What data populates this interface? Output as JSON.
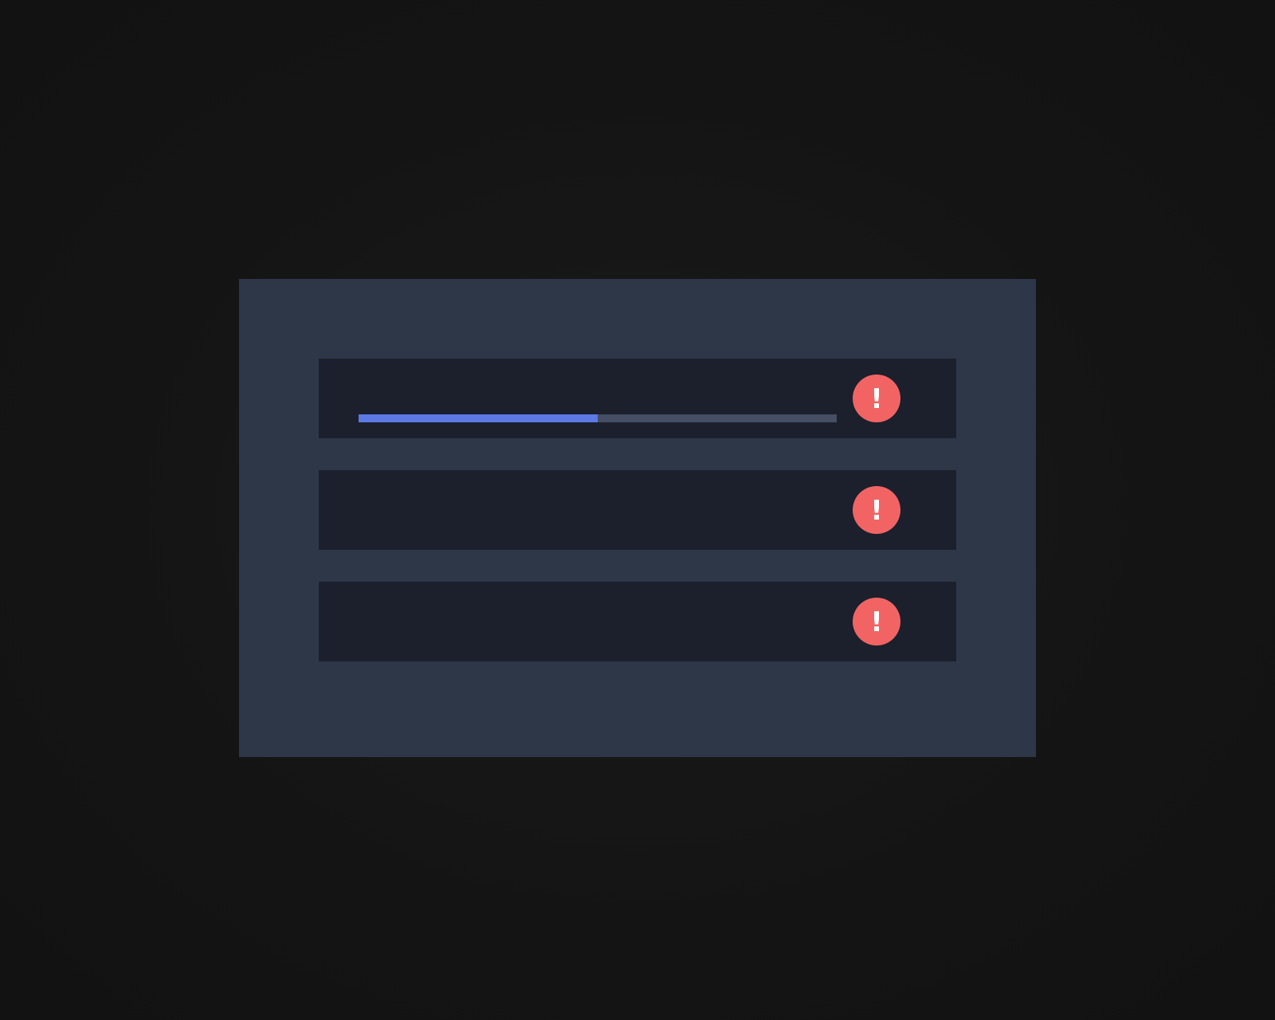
{
  "colors": {
    "background": "#141414",
    "panel": "#2e3748",
    "row": "#1b202c",
    "progress_track": "#454e62",
    "progress_fill": "#5d79e6",
    "alert": "#f26464"
  },
  "rows": [
    {
      "progress": 0.5,
      "status_icon": "alert-exclamation-icon",
      "status_glyph": "!"
    },
    {
      "status_icon": "alert-exclamation-icon",
      "status_glyph": "!"
    },
    {
      "status_icon": "alert-exclamation-icon",
      "status_glyph": "!"
    }
  ]
}
